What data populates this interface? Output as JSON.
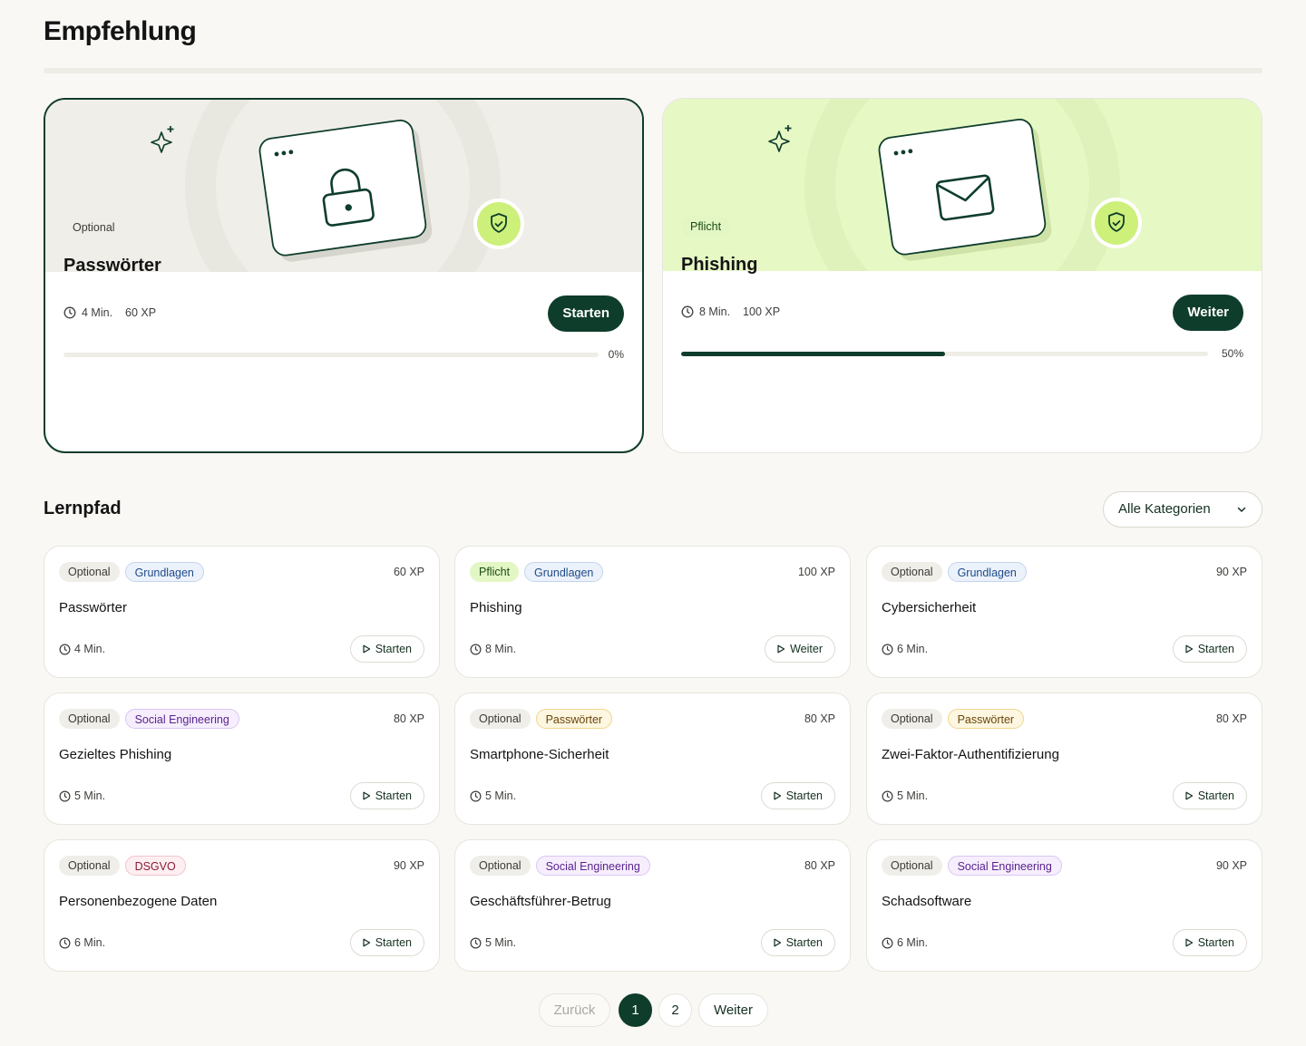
{
  "header": {
    "title": "Empfehlung"
  },
  "featured": [
    {
      "tag": "Optional",
      "title": "Passwörter",
      "duration": "4 Min.",
      "xp": "60 XP",
      "button": "Starten",
      "progress_label": "0%",
      "progress": 0,
      "illustration": "lock-icon",
      "badge": "shield-check-icon"
    },
    {
      "tag": "Pflicht",
      "title": "Phishing",
      "duration": "8 Min.",
      "xp": "100 XP",
      "button": "Weiter",
      "progress_label": "50%",
      "progress": 0.5,
      "illustration": "mail-icon",
      "badge": "shield-check-icon"
    }
  ],
  "learning_path": {
    "title": "Lernpfad",
    "category_select": "Alle Kategorien",
    "items": [
      {
        "status": "Optional",
        "category": "Grundlagen",
        "xp": "60 XP",
        "title": "Passwörter",
        "duration": "4 Min.",
        "button": "Starten"
      },
      {
        "status": "Pflicht",
        "category": "Grundlagen",
        "xp": "100 XP",
        "title": "Phishing",
        "duration": "8 Min.",
        "button": "Weiter"
      },
      {
        "status": "Optional",
        "category": "Grundlagen",
        "xp": "90 XP",
        "title": "Cybersicherheit",
        "duration": "6 Min.",
        "button": "Starten"
      },
      {
        "status": "Optional",
        "category": "Social Engineering",
        "xp": "80 XP",
        "title": "Gezieltes Phishing",
        "duration": "5 Min.",
        "button": "Starten"
      },
      {
        "status": "Optional",
        "category": "Passwörter",
        "xp": "80 XP",
        "title": "Smartphone-Sicherheit",
        "duration": "5 Min.",
        "button": "Starten"
      },
      {
        "status": "Optional",
        "category": "Passwörter",
        "xp": "80 XP",
        "title": "Zwei-Faktor-Authentifizierung",
        "duration": "5 Min.",
        "button": "Starten"
      },
      {
        "status": "Optional",
        "category": "DSGVO",
        "xp": "90 XP",
        "title": "Personenbezogene Daten",
        "duration": "6 Min.",
        "button": "Starten"
      },
      {
        "status": "Optional",
        "category": "Social Engineering",
        "xp": "80 XP",
        "title": "Geschäftsführer-Betrug",
        "duration": "5 Min.",
        "button": "Starten"
      },
      {
        "status": "Optional",
        "category": "Social Engineering",
        "xp": "90 XP",
        "title": "Schadsoftware",
        "duration": "6 Min.",
        "button": "Starten"
      }
    ]
  },
  "pagination": {
    "prev": "Zurück",
    "pages": [
      "1",
      "2"
    ],
    "current": "1",
    "next": "Weiter"
  },
  "colors": {
    "primary": "#0f3d2c",
    "accent_lime": "#ccf07a",
    "hero_neutral": "#efeee8",
    "hero_green": "#e6f8c4"
  }
}
